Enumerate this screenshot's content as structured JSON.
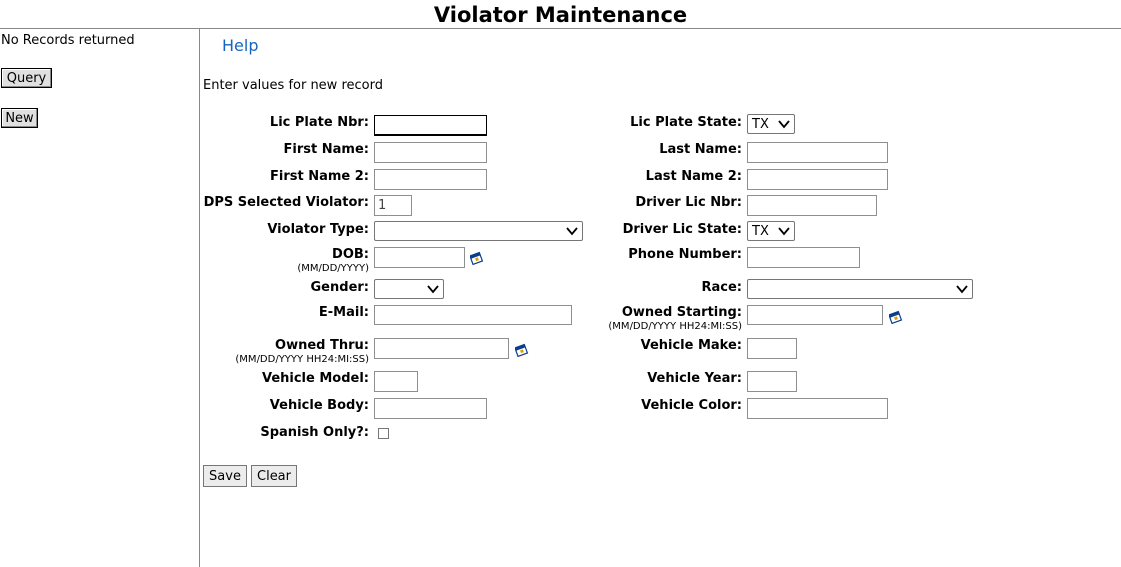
{
  "page": {
    "title": "Violator Maintenance"
  },
  "sidebar": {
    "message": "No Records returned",
    "query_label": "Query",
    "new_label": "New"
  },
  "main": {
    "help_label": "Help",
    "instruction": "Enter values for new record",
    "fields": {
      "lic_plate_nbr": {
        "label": "Lic Plate Nbr:",
        "value": ""
      },
      "lic_plate_state": {
        "label": "Lic Plate State:",
        "value": "TX"
      },
      "first_name": {
        "label": "First Name:",
        "value": ""
      },
      "last_name": {
        "label": "Last Name:",
        "value": ""
      },
      "first_name_2": {
        "label": "First Name 2:",
        "value": ""
      },
      "last_name_2": {
        "label": "Last Name 2:",
        "value": ""
      },
      "dps_selected_violator": {
        "label": "DPS Selected Violator:",
        "value": "1"
      },
      "driver_lic_nbr": {
        "label": "Driver Lic Nbr:",
        "value": ""
      },
      "violator_type": {
        "label": "Violator Type:",
        "value": ""
      },
      "driver_lic_state": {
        "label": "Driver Lic State:",
        "value": "TX"
      },
      "dob": {
        "label": "DOB:",
        "hint": "(MM/DD/YYYY)",
        "value": ""
      },
      "phone_number": {
        "label": "Phone Number:",
        "value": ""
      },
      "gender": {
        "label": "Gender:",
        "value": ""
      },
      "race": {
        "label": "Race:",
        "value": ""
      },
      "email": {
        "label": "E-Mail:",
        "value": ""
      },
      "owned_starting": {
        "label": "Owned Starting:",
        "hint": "(MM/DD/YYYY HH24:MI:SS)",
        "value": ""
      },
      "owned_thru": {
        "label": "Owned Thru:",
        "hint": "(MM/DD/YYYY HH24:MI:SS)",
        "value": ""
      },
      "vehicle_make": {
        "label": "Vehicle Make:",
        "value": ""
      },
      "vehicle_model": {
        "label": "Vehicle Model:",
        "value": ""
      },
      "vehicle_year": {
        "label": "Vehicle Year:",
        "value": ""
      },
      "vehicle_body": {
        "label": "Vehicle Body:",
        "value": ""
      },
      "vehicle_color": {
        "label": "Vehicle Color:",
        "value": ""
      },
      "spanish_only": {
        "label": "Spanish Only?:",
        "checked": false
      }
    },
    "save_label": "Save",
    "clear_label": "Clear"
  },
  "icons": {
    "calendar": "calendar-icon",
    "dropdown": "chevron-down-icon"
  },
  "colors": {
    "help_link": "#1565c0",
    "rule": "#888888"
  }
}
